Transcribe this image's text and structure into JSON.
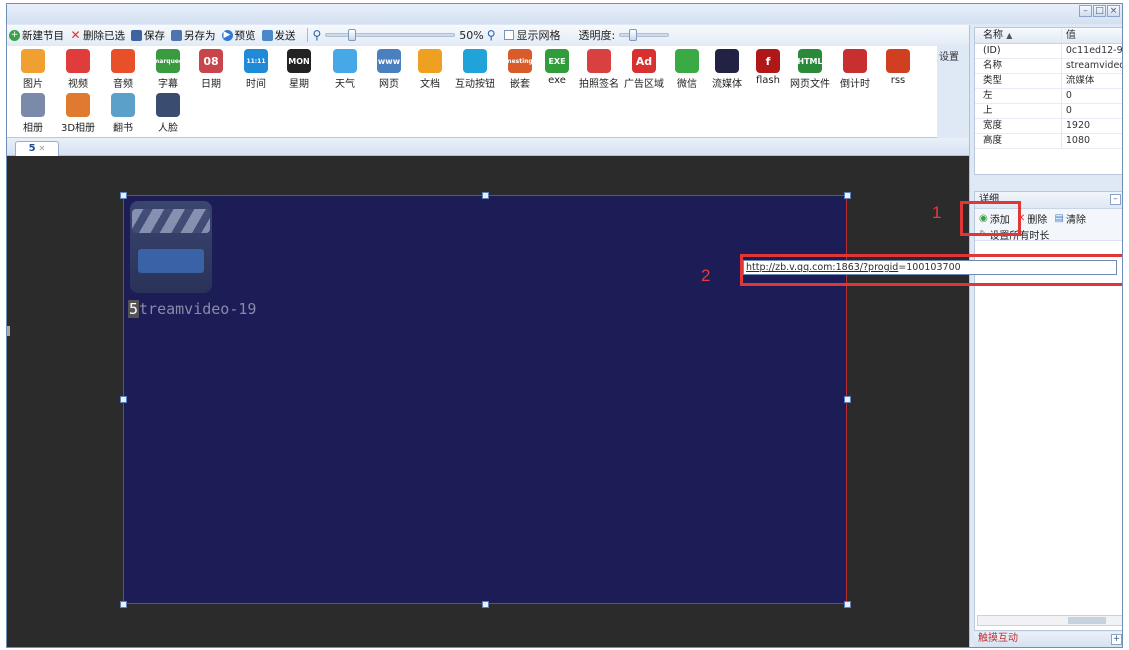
{
  "window": {
    "controls": [
      "–",
      "□",
      "×"
    ]
  },
  "toolbar": {
    "new_label": "新建节目",
    "delete_label": "删除已选",
    "save_label": "保存",
    "save_as_label": "另存为",
    "preview_label": "预览",
    "send_label": "发送",
    "zoom_value": "50%",
    "grid_label": "显示网格",
    "opacity_label": "透明度:",
    "zoom_level": 0.18,
    "opacity_level": 0.2
  },
  "palette": {
    "row1": [
      {
        "label": "图片",
        "icon": "image-icon",
        "color": "#f0a030"
      },
      {
        "label": "视频",
        "icon": "video-icon",
        "color": "#e03c3c"
      },
      {
        "label": "音频",
        "icon": "music-icon",
        "color": "#e8502a"
      },
      {
        "label": "字幕",
        "icon": "marquee-icon",
        "color": "#3a9a40",
        "text": "marquee"
      },
      {
        "label": "日期",
        "icon": "calendar-icon",
        "color": "#c8454b",
        "text": "08"
      },
      {
        "label": "时间",
        "icon": "clock-icon",
        "color": "#1f8ad8",
        "text": "11:11"
      },
      {
        "label": "星期",
        "icon": "weekday-icon",
        "color": "#222222",
        "text": "MON"
      },
      {
        "label": "天气",
        "icon": "weather-icon",
        "color": "#47a8e8"
      },
      {
        "label": "网页",
        "icon": "web-icon",
        "color": "#4a7fc0",
        "text": "www"
      },
      {
        "label": "文档",
        "icon": "document-icon",
        "color": "#f0a020"
      },
      {
        "label": "互动按钮",
        "icon": "touch-button-icon",
        "color": "#1fa3d8"
      },
      {
        "label": "嵌套",
        "icon": "nesting-icon",
        "color": "#d95b2a",
        "text": "nesting"
      },
      {
        "label": "exe",
        "icon": "exe-icon",
        "color": "#2f9e3a",
        "text": "EXE"
      },
      {
        "label": "拍照签名",
        "icon": "photo-sign-icon",
        "color": "#d94040"
      },
      {
        "label": "广告区域",
        "icon": "ad-icon",
        "color": "#d93030",
        "text": "Ad"
      },
      {
        "label": "微信",
        "icon": "wechat-icon",
        "color": "#3aaa45"
      },
      {
        "label": "流媒体",
        "icon": "stream-icon",
        "color": "#222244"
      },
      {
        "label": "flash",
        "icon": "flash-icon",
        "color": "#b01818",
        "text": "f"
      },
      {
        "label": "网页文件",
        "icon": "html-icon",
        "color": "#2a8a3a",
        "text": "HTML"
      },
      {
        "label": "倒计时",
        "icon": "hourglass-icon",
        "color": "#c83030"
      },
      {
        "label": "rss",
        "icon": "rss-icon",
        "color": "#d04020"
      }
    ],
    "row2": [
      {
        "label": "相册",
        "icon": "album-icon",
        "color": "#7a8aa8"
      },
      {
        "label": "3D相册",
        "icon": "3d-album-icon",
        "color": "#e07a30"
      },
      {
        "label": "翻书",
        "icon": "flipbook-icon",
        "color": "#5aa0c8"
      },
      {
        "label": "人脸",
        "icon": "face-icon",
        "color": "#3a4c70"
      }
    ],
    "settings_label": "设置"
  },
  "tabs": [
    {
      "label": "5"
    }
  ],
  "stage": {
    "item_index": "5",
    "item_name": "treamvideo-19"
  },
  "annotations": {
    "num1": "1",
    "num2": "2",
    "url_prefix": "http://zb.v.qq.com:1863/?",
    "url_param": "progid",
    "url_suffix": "=100103700"
  },
  "properties": {
    "header": {
      "name": "名称",
      "value": "值"
    },
    "rows": [
      {
        "name": "(ID)",
        "value": "0c11ed12-9..."
      },
      {
        "name": "名称",
        "value": "streamvideo..."
      },
      {
        "name": "类型",
        "value": "流媒体"
      },
      {
        "name": "左",
        "value": "0"
      },
      {
        "name": "上",
        "value": "0"
      },
      {
        "name": "宽度",
        "value": "1920"
      },
      {
        "name": "高度",
        "value": "1080"
      }
    ]
  },
  "detail": {
    "title": "详细",
    "add_label": "添加",
    "delete_label": "删除",
    "clear_label": "清除",
    "set_all_label": "设置所有时长"
  },
  "footer": {
    "label": "触摸互动"
  },
  "colors": {
    "stage_bg": "#1c1c57",
    "canvas_bg": "#2b2b2b",
    "annotation": "#e23636"
  }
}
